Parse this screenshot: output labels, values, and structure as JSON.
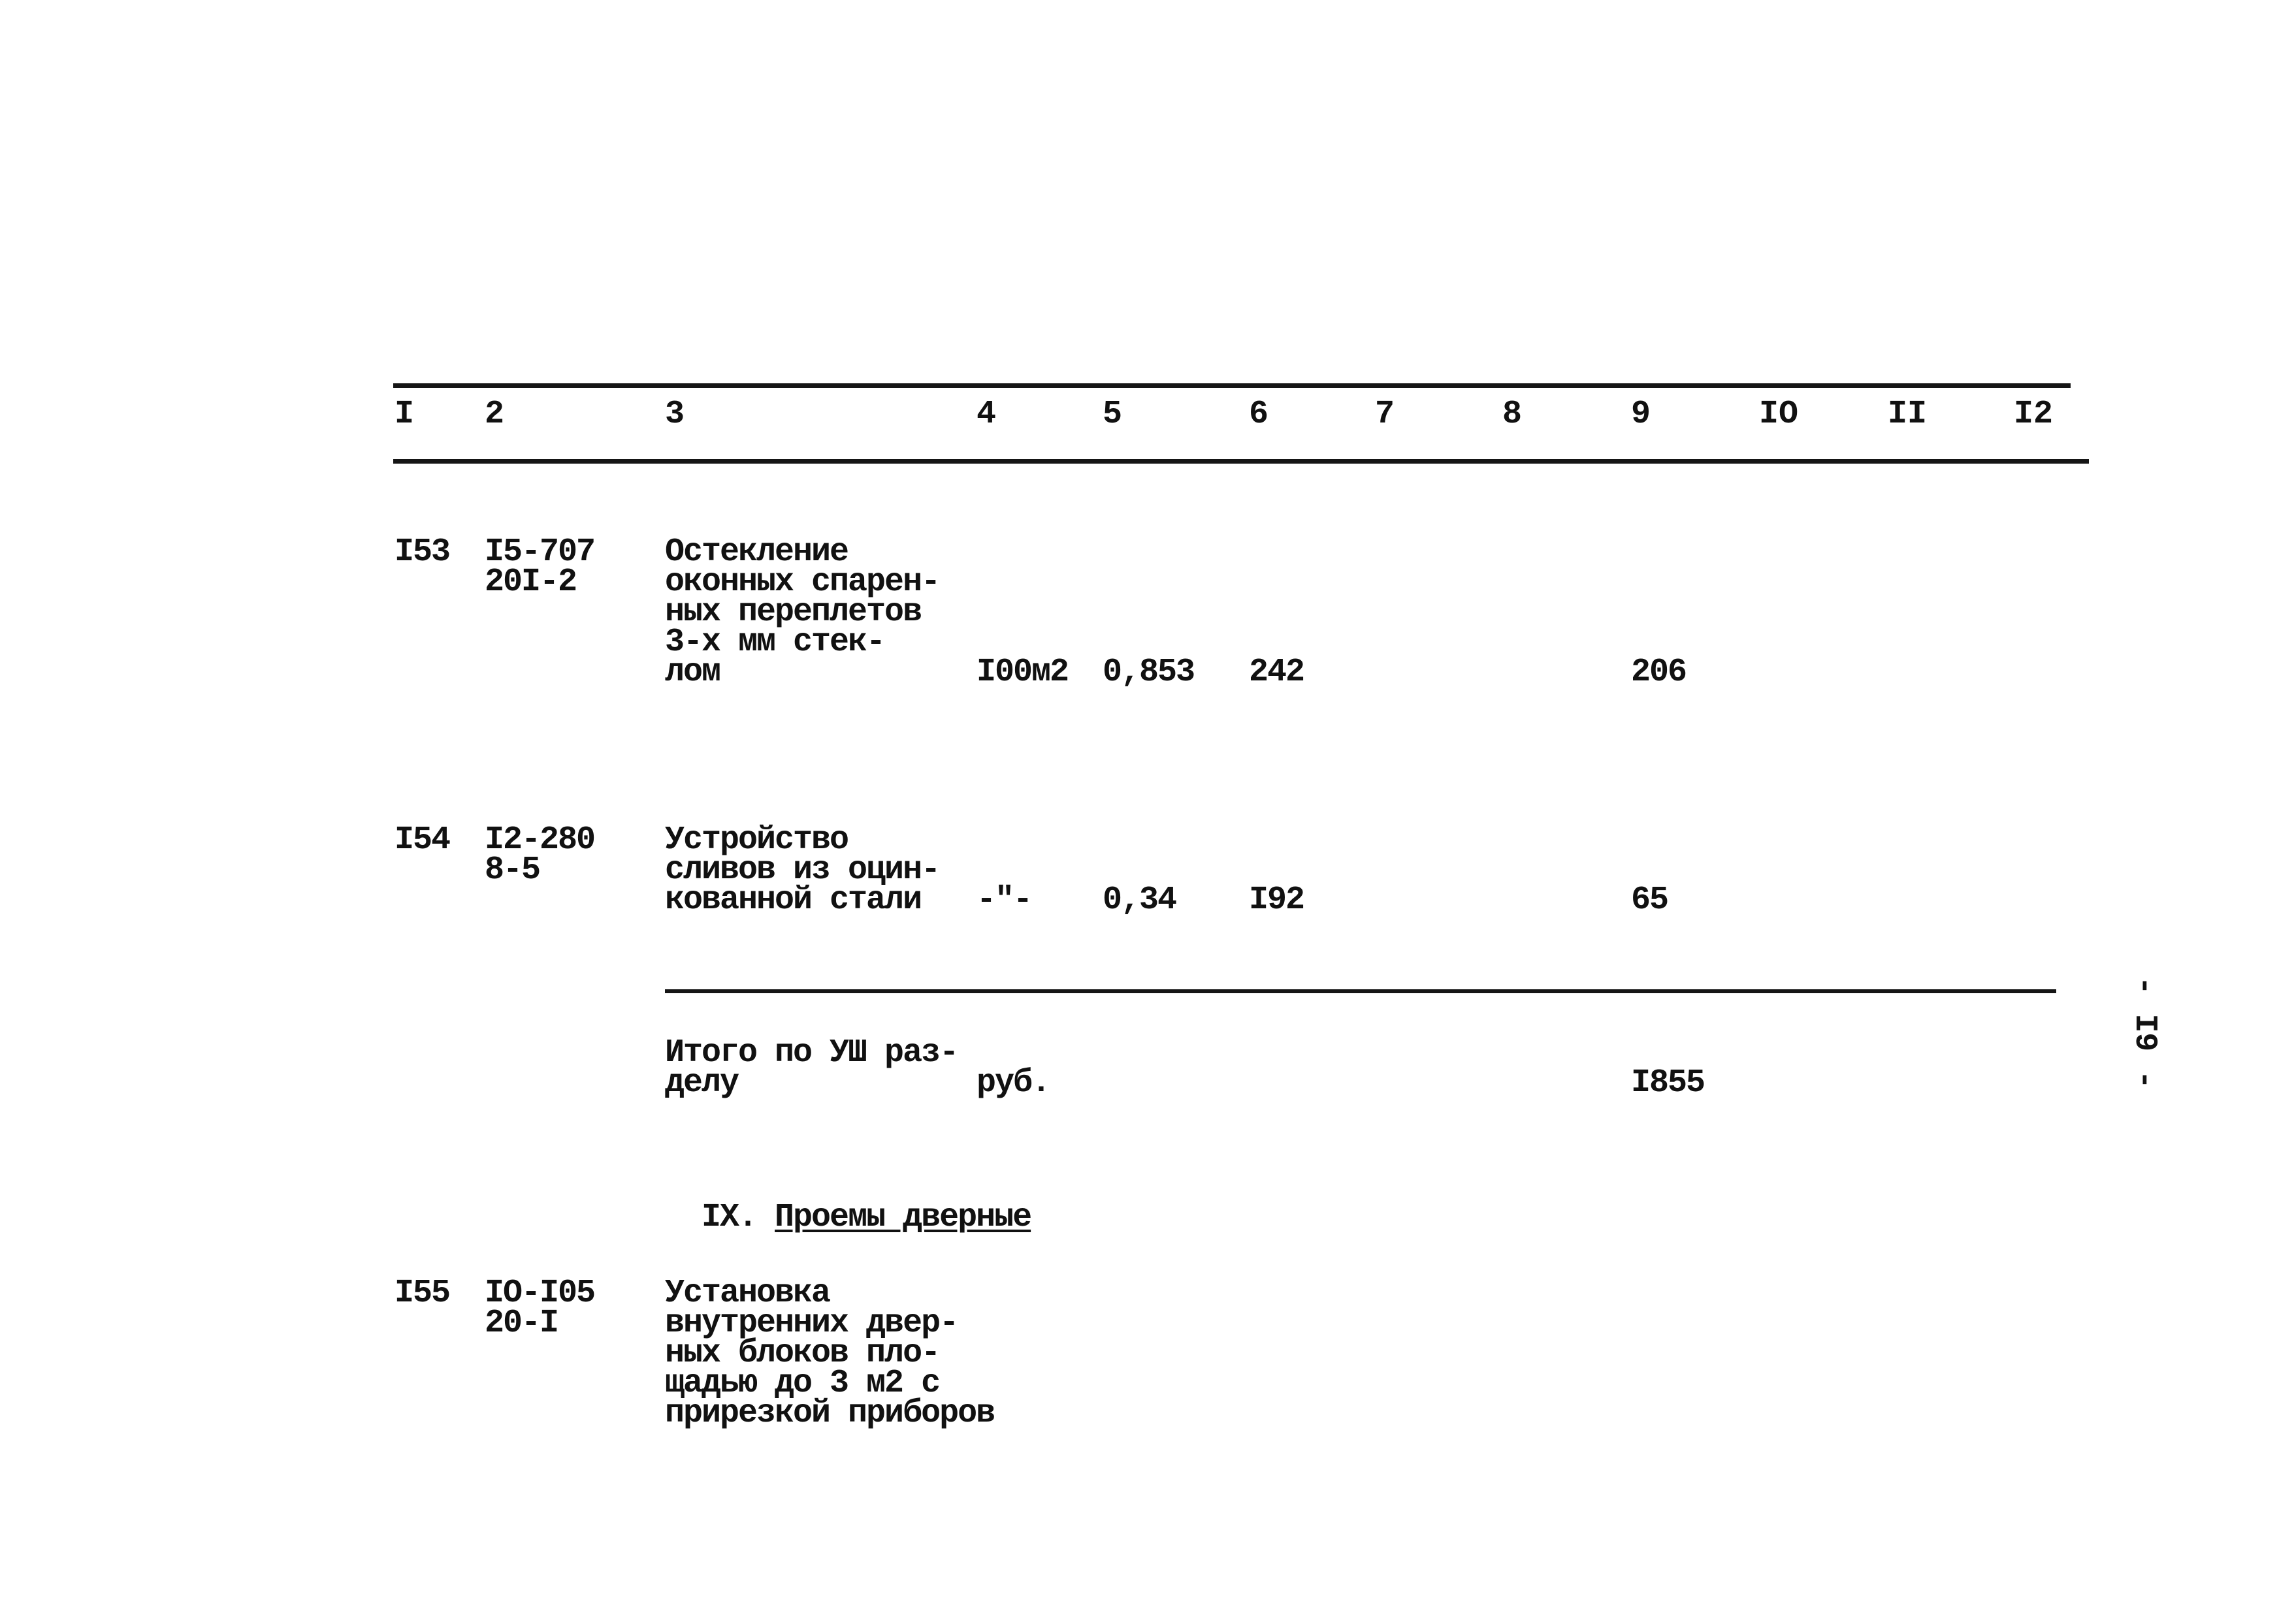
{
  "header": {
    "columns": [
      "I",
      "2",
      "3",
      "4",
      "5",
      "6",
      "7",
      "8",
      "9",
      "IO",
      "II",
      "I2"
    ]
  },
  "rows": [
    {
      "num": "I53",
      "code": [
        "I5-707",
        "20I-2"
      ],
      "description": [
        "Остекление",
        "оконных спарен-",
        "ных переплетов",
        "3-х мм стек-",
        "лом"
      ],
      "unit": "I00м2",
      "quantity": "0,853",
      "col6": "242",
      "col9": "206"
    },
    {
      "num": "I54",
      "code": [
        "I2-280",
        "8-5"
      ],
      "description": [
        "Устройство",
        "сливов из оцин-",
        "кованной стали"
      ],
      "unit": "-\"-",
      "quantity": "0,34",
      "col6": "I92",
      "col9": "65"
    }
  ],
  "subtotal": {
    "label": [
      "Итого по УШ раз-",
      "делу"
    ],
    "unit": "руб.",
    "col9": "I855"
  },
  "section": {
    "number": "IX.",
    "title": "Проемы дверные"
  },
  "rows2": [
    {
      "num": "I55",
      "code": [
        "IO-I05",
        "20-I"
      ],
      "description": [
        "Установка",
        "внутренних двер-",
        "ных блоков пло-",
        "щадью до 3 м2 с",
        "прирезкой приборов"
      ]
    }
  ],
  "page_number": "- I9 -"
}
